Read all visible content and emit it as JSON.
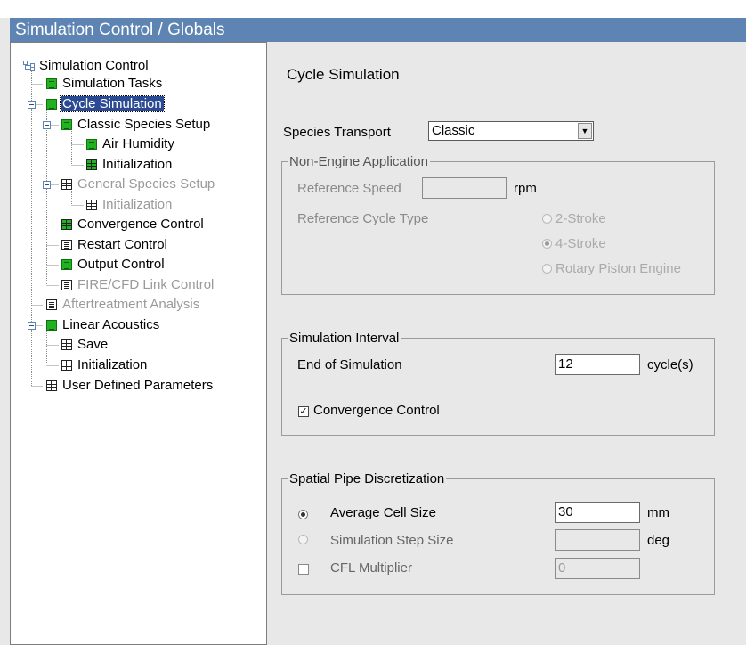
{
  "window": {
    "title": "Simulation Control / Globals"
  },
  "tree": {
    "items": [
      {
        "label": "Simulation Control"
      },
      {
        "label": "Simulation Tasks"
      },
      {
        "label": "Cycle Simulation"
      },
      {
        "label": "Classic Species Setup"
      },
      {
        "label": "Air Humidity"
      },
      {
        "label": "Initialization"
      },
      {
        "label": "General Species Setup"
      },
      {
        "label": "Initialization"
      },
      {
        "label": "Convergence Control"
      },
      {
        "label": "Restart Control"
      },
      {
        "label": "Output Control"
      },
      {
        "label": "FIRE/CFD Link Control"
      },
      {
        "label": "Aftertreatment Analysis"
      },
      {
        "label": "Linear Acoustics"
      },
      {
        "label": "Save"
      },
      {
        "label": "Initialization"
      },
      {
        "label": "User Defined Parameters"
      }
    ],
    "selected": "Cycle Simulation"
  },
  "main": {
    "heading": "Cycle Simulation",
    "species_transport": {
      "label": "Species Transport",
      "value": "Classic"
    },
    "non_engine": {
      "legend": "Non-Engine Application",
      "reference_speed_label": "Reference Speed",
      "reference_speed_value": "",
      "reference_speed_unit": "rpm",
      "cycle_type_label": "Reference Cycle Type",
      "options": [
        "2-Stroke",
        "4-Stroke",
        "Rotary Piston Engine"
      ],
      "selected_option": "4-Stroke"
    },
    "interval": {
      "legend": "Simulation Interval",
      "end_label": "End of Simulation",
      "end_value": "12",
      "end_unit": "cycle(s)",
      "convergence_label": "Convergence Control",
      "convergence_checked": true
    },
    "spatial": {
      "legend": "Spatial Pipe Discretization",
      "avg_cell_label": "Average Cell Size",
      "avg_cell_value": "30",
      "avg_cell_unit": "mm",
      "step_label": "Simulation Step Size",
      "step_value": "",
      "step_unit": "deg",
      "cfl_label": "CFL Multiplier",
      "cfl_value": "0",
      "selected": "Average Cell Size"
    }
  },
  "colors": {
    "titlebar": "#5d84b2",
    "selection": "#2b4a94",
    "panel": "#e8e8e8"
  }
}
